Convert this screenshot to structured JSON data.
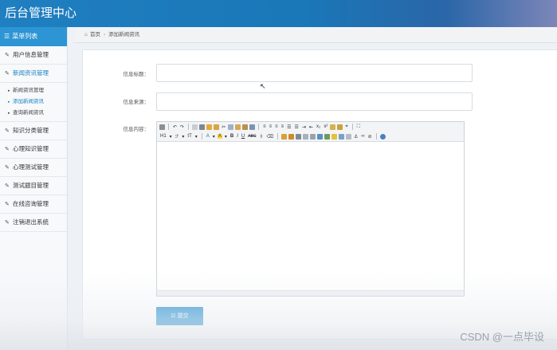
{
  "app": {
    "title": "后台管理中心"
  },
  "sidebar": {
    "header": "菜单列表",
    "items": [
      {
        "label": "用户信息管理"
      },
      {
        "label": "新闻资讯管理",
        "active": true,
        "subitems": [
          {
            "label": "新闻资讯管理"
          },
          {
            "label": "添加新闻资讯",
            "active": true
          },
          {
            "label": "查询新闻资讯"
          }
        ]
      },
      {
        "label": "知识分类管理"
      },
      {
        "label": "心理知识管理"
      },
      {
        "label": "心理测试管理"
      },
      {
        "label": "测试题目管理"
      },
      {
        "label": "在线咨询管理"
      },
      {
        "label": "注销退出系统"
      }
    ]
  },
  "breadcrumb": {
    "home": "首页",
    "current": "添加新闻资讯"
  },
  "form": {
    "title_label": "信息标题：",
    "title_value": "",
    "source_label": "信息来源：",
    "source_value": "",
    "content_label": "信息内容：",
    "submit_label": "提交"
  },
  "editor_toolbar": {
    "heading": "H1",
    "font_family": "ℱ",
    "font_size": "tT",
    "font_color": "A",
    "bold": "B",
    "italic": "I",
    "underline": "U",
    "strike": "ABC"
  },
  "watermark": "CSDN @一点毕设",
  "colors": {
    "accent": "#2d95d3",
    "topbar": "#1f7fc0"
  }
}
